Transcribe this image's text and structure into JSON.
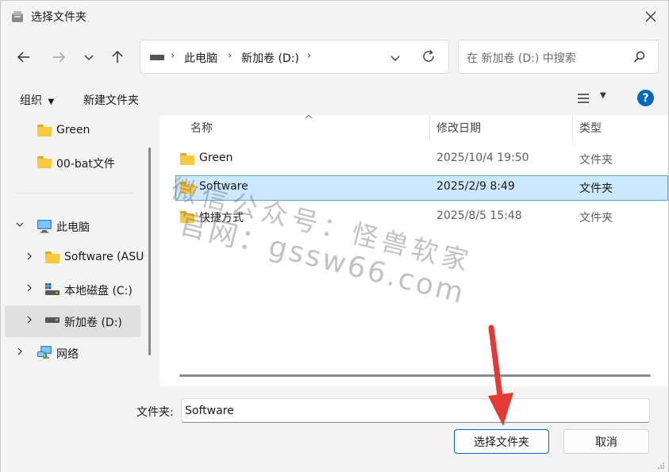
{
  "window": {
    "title": "选择文件夹"
  },
  "address": {
    "parts": [
      "此电脑",
      "新加卷 (D:)"
    ]
  },
  "search": {
    "placeholder": "在 新加卷 (D:) 中搜索"
  },
  "toolbar": {
    "organize": "组织",
    "new_folder": "新建文件夹"
  },
  "nav_pane": {
    "items": [
      {
        "label": "Green",
        "icon": "folder-icon"
      },
      {
        "label": "00-bat文件",
        "icon": "folder-icon"
      },
      {
        "label": "此电脑",
        "icon": "computer-icon"
      },
      {
        "label": "Software (ASU",
        "icon": "folder-icon"
      },
      {
        "label": "本地磁盘 (C:)",
        "icon": "drive-icon"
      },
      {
        "label": "新加卷 (D:)",
        "icon": "drive-icon"
      },
      {
        "label": "网络",
        "icon": "network-icon"
      }
    ]
  },
  "file_list": {
    "columns": {
      "name": "名称",
      "date": "修改日期",
      "type": "类型"
    },
    "rows": [
      {
        "name": "Green",
        "date": "2025/10/4 19:50",
        "type": "文件夹",
        "selected": false
      },
      {
        "name": "Software",
        "date": "2025/2/9 8:49",
        "type": "文件夹",
        "selected": true
      },
      {
        "name": "快捷方式",
        "date": "2025/8/5 15:48",
        "type": "文件夹",
        "selected": false
      }
    ]
  },
  "watermark": {
    "line1": "微信公众号：怪兽软家",
    "line2": "官网：gssw66.com"
  },
  "bottom": {
    "folder_label": "文件夹:",
    "folder_value": "Software",
    "select_button": "选择文件夹",
    "cancel_button": "取消"
  },
  "colors": {
    "accent": "#0067c0",
    "selection": "#cce8ff",
    "annotation_arrow": "#e53935"
  }
}
